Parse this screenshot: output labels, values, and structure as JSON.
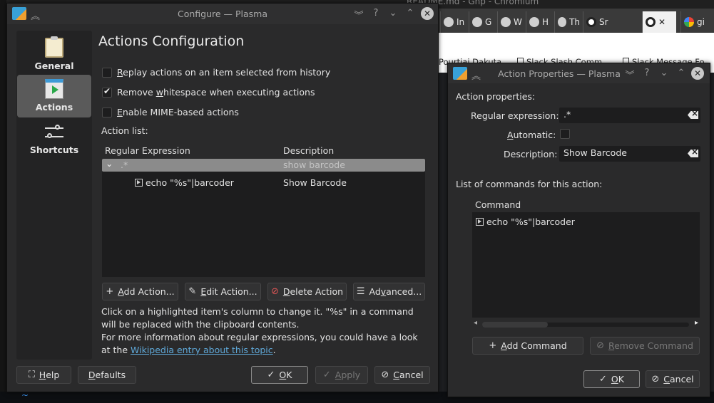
{
  "browser": {
    "title": "README.md - Gnp - Chromium",
    "tabs": [
      "In",
      "G",
      "W",
      "H",
      "Th",
      "Sr",
      "gi"
    ],
    "bookmarks": [
      "Pourtiai Dakuta",
      "Slack Slash Comm",
      "Slack Message Fo"
    ],
    "terminal_prompt": "~"
  },
  "configure": {
    "title": "Configure — Plasma",
    "categories": [
      {
        "label": "General",
        "icon": "clipboard-icon"
      },
      {
        "label": "Actions",
        "icon": "actions-icon"
      },
      {
        "label": "Shortcuts",
        "icon": "sliders-icon"
      }
    ],
    "heading": "Actions Configuration",
    "options": {
      "replay": {
        "pre": "",
        "acc": "R",
        "post": "eplay actions on an item selected from history",
        "checked": false
      },
      "whitespace": {
        "pre": "Remove ",
        "acc": "w",
        "post": "hitespace when executing actions",
        "checked": true
      },
      "mime": {
        "pre": "",
        "acc": "E",
        "post": "nable MIME-based actions",
        "checked": false
      }
    },
    "action_list_label": "Action list:",
    "columns": {
      "regex": "Regular Expression",
      "desc": "Description"
    },
    "rows": [
      {
        "regex": ".*",
        "desc": "show barcode"
      },
      {
        "command": "echo \"%s\"|barcoder",
        "desc": "Show Barcode"
      }
    ],
    "buttons": {
      "add": {
        "acc": "A",
        "post": "dd Action..."
      },
      "edit": {
        "acc": "E",
        "post": "dit Action..."
      },
      "delete": {
        "acc": "D",
        "post": "elete Action"
      },
      "advanced": {
        "pre": "Ad",
        "acc": "v",
        "post": "anced..."
      }
    },
    "help": {
      "line1": "Click on a highlighted item's column to change it. \"%s\" in a command will be replaced with the clipboard contents.",
      "line2": "For more information about regular expressions, you could have a look at the ",
      "link": "Wikipedia entry about this topic",
      "end": "."
    },
    "footer": {
      "help": {
        "acc": "H",
        "post": "elp"
      },
      "defaults": {
        "acc": "D",
        "post": "efaults"
      },
      "ok": {
        "acc": "O",
        "post": "K"
      },
      "apply": {
        "acc": "A",
        "post": "pply"
      },
      "cancel": {
        "acc": "C",
        "post": "ancel"
      }
    }
  },
  "props": {
    "title": "Action Properties — Plasma",
    "section": "Action properties:",
    "regex_label": "Regular expression:",
    "regex_value": ".*",
    "automatic_label": {
      "acc": "A",
      "post": "utomatic:"
    },
    "automatic_checked": false,
    "description_label": "Description:",
    "description_value": "Show Barcode",
    "commands_label": "List of commands for this action:",
    "command_header": "Command",
    "commands": [
      "echo \"%s\"|barcoder"
    ],
    "add_command": {
      "acc": "A",
      "post": "dd Command"
    },
    "remove_command": {
      "acc": "R",
      "post": "emove Command"
    },
    "ok": {
      "acc": "O",
      "post": "K"
    },
    "cancel": {
      "acc": "C",
      "post": "ancel"
    }
  }
}
